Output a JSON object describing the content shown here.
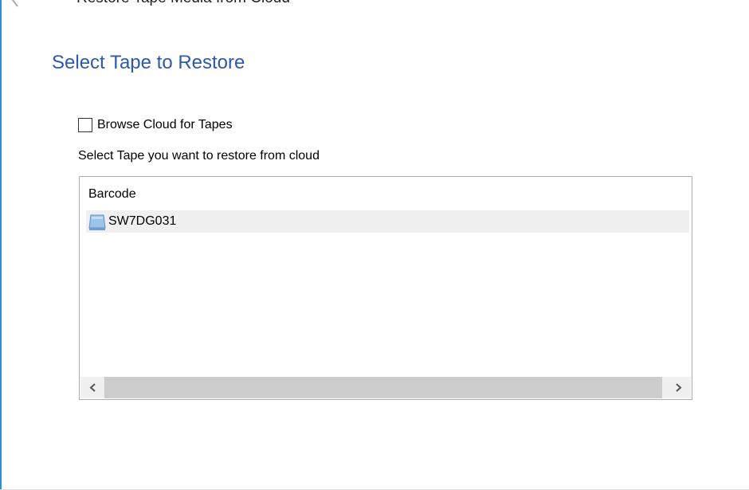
{
  "window": {
    "title": "Restore Tape Media from Cloud",
    "back_icon": "back-arrow-icon"
  },
  "page": {
    "title": "Select Tape to Restore"
  },
  "browse_cloud": {
    "label": "Browse Cloud for Tapes",
    "checked": false
  },
  "instruction": "Select Tape you want to restore from cloud",
  "tape_list": {
    "column_header": "Barcode",
    "rows": [
      {
        "barcode": "SW7DG031",
        "icon": "tape-icon",
        "highlighted": true
      }
    ]
  },
  "scrollbar": {
    "left_icon": "chevron-left-icon",
    "right_icon": "chevron-right-icon"
  },
  "colors": {
    "title": "#2c5aa8",
    "accent_border": "#2b8fd8",
    "row_highlight": "#f0f0f0"
  }
}
